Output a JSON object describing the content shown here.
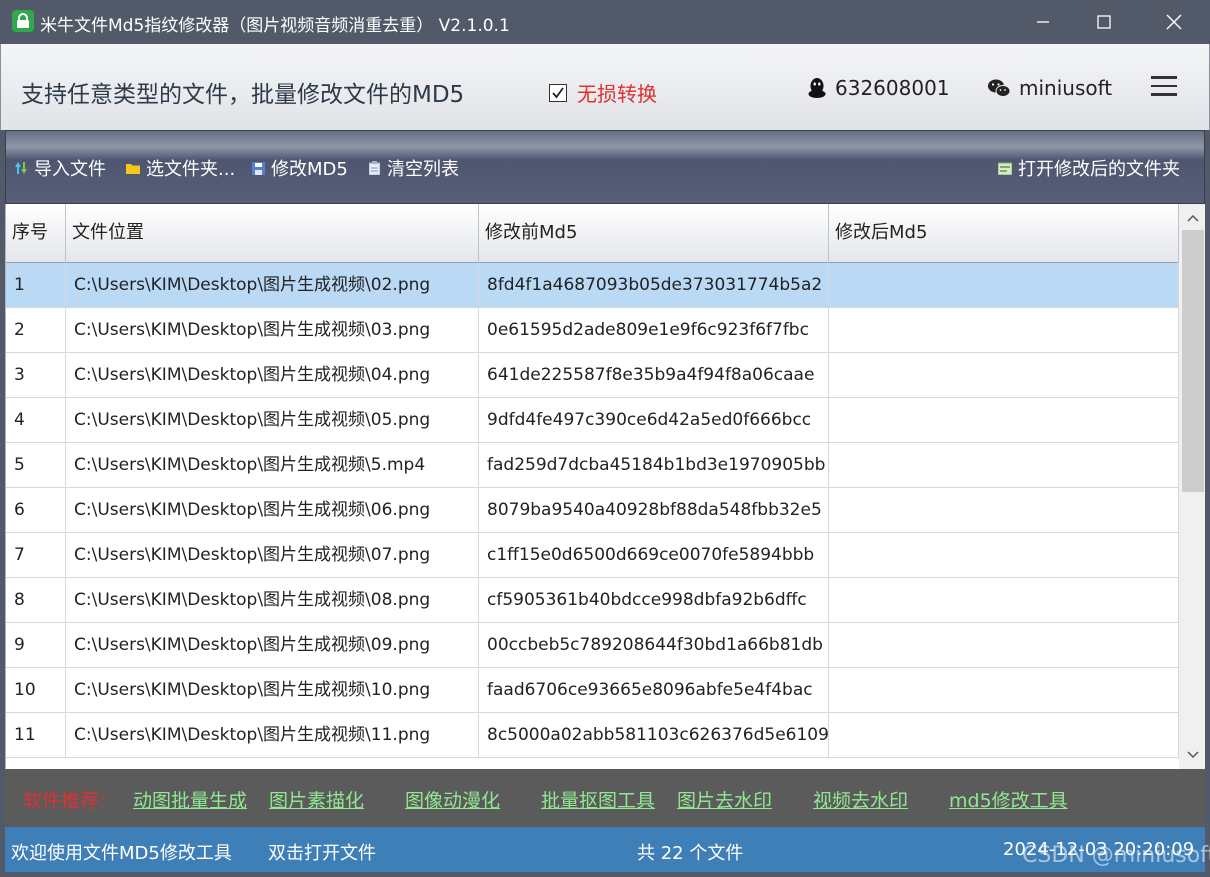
{
  "window": {
    "title": "米牛文件Md5指纹修改器（图片视频音频消重去重） V2.1.0.1",
    "controls": [
      "minimize",
      "maximize",
      "close"
    ]
  },
  "header": {
    "slogan": "支持任意类型的文件，批量修改文件的MD5",
    "lossless_checked": true,
    "lossless_label": "无损转换",
    "qq": "632608001",
    "wechat": "miniusoft",
    "menu_icon": "hamburger-icon"
  },
  "toolbar": {
    "import": "导入文件",
    "select_folder": "选文件夹...",
    "modify": "修改MD5",
    "clear": "清空列表",
    "open_folder": "打开修改后的文件夹"
  },
  "table": {
    "columns": [
      "序号",
      "文件位置",
      "修改前Md5",
      "修改后Md5"
    ],
    "rows": [
      [
        "1",
        "C:\\Users\\KIM\\Desktop\\图片生成视频\\02.png",
        "8fd4f1a4687093b05de373031774b5a2",
        ""
      ],
      [
        "2",
        "C:\\Users\\KIM\\Desktop\\图片生成视频\\03.png",
        "0e61595d2ade809e1e9f6c923f6f7fbc",
        ""
      ],
      [
        "3",
        "C:\\Users\\KIM\\Desktop\\图片生成视频\\04.png",
        "641de225587f8e35b9a4f94f8a06caae",
        ""
      ],
      [
        "4",
        "C:\\Users\\KIM\\Desktop\\图片生成视频\\05.png",
        "9dfd4fe497c390ce6d42a5ed0f666bcc",
        ""
      ],
      [
        "5",
        "C:\\Users\\KIM\\Desktop\\图片生成视频\\5.mp4",
        "fad259d7dcba45184b1bd3e1970905bb",
        ""
      ],
      [
        "6",
        "C:\\Users\\KIM\\Desktop\\图片生成视频\\06.png",
        "8079ba9540a40928bf88da548fbb32e5",
        ""
      ],
      [
        "7",
        "C:\\Users\\KIM\\Desktop\\图片生成视频\\07.png",
        "c1ff15e0d6500d669ce0070fe5894bbb",
        ""
      ],
      [
        "8",
        "C:\\Users\\KIM\\Desktop\\图片生成视频\\08.png",
        "cf5905361b40bdcce998dbfa92b6dffc",
        ""
      ],
      [
        "9",
        "C:\\Users\\KIM\\Desktop\\图片生成视频\\09.png",
        "00ccbeb5c789208644f30bd1a66b81db",
        ""
      ],
      [
        "10",
        "C:\\Users\\KIM\\Desktop\\图片生成视频\\10.png",
        "faad6706ce93665e8096abfe5e4f4bac",
        ""
      ],
      [
        "11",
        "C:\\Users\\KIM\\Desktop\\图片生成视频\\11.png",
        "8c5000a02abb581103c626376d5e6109",
        ""
      ]
    ],
    "selected_row": 1
  },
  "recommend": {
    "label": "软件推荐:",
    "links": [
      "动图批量生成",
      "图片素描化",
      "图像动漫化",
      "批量抠图工具",
      "图片去水印",
      "视频去水印",
      "md5修改工具"
    ]
  },
  "status": {
    "welcome": "欢迎使用文件MD5修改工具",
    "hint": "双击打开文件",
    "count": "共 22 个文件",
    "datetime": "2024-12-03 20:20:09",
    "watermark": "CSDN @miniusoft"
  },
  "colors": {
    "titlebar": "#525a69",
    "selected_row": "#b9d9f5",
    "statusbar": "#3f7fb8",
    "lossless_text": "#e03030",
    "rec_link": "#90e890"
  }
}
